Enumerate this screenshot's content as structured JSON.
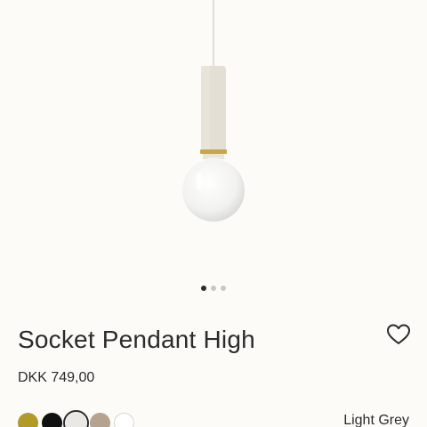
{
  "product": {
    "name": "Socket Pendant High",
    "price": "DKK 749,00",
    "selected_color_name": "Light Grey"
  },
  "gallery": {
    "image_icon": "pendant-lamp-image",
    "current_index": 1,
    "total": 3
  },
  "swatches": [
    {
      "color": "#b19a28",
      "label_hidden": true
    },
    {
      "color": "#111111",
      "label_hidden": true
    },
    {
      "color": "#e9e8e3",
      "selected": true
    },
    {
      "color": "#b3a38f"
    },
    {
      "color": "#ffffff"
    }
  ],
  "icons": {
    "favorite": "heart-icon"
  }
}
